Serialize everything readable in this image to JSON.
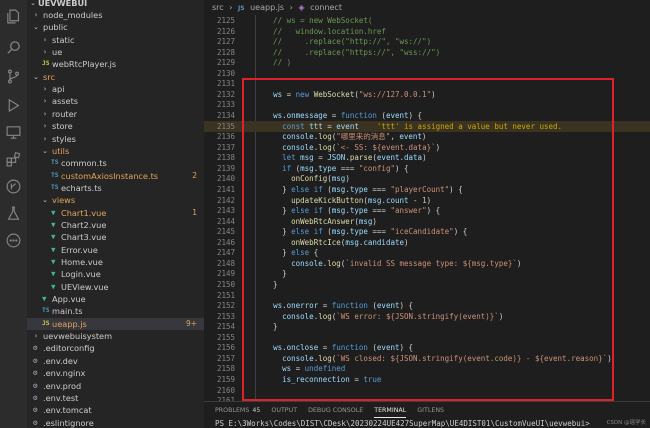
{
  "explorer": {
    "root": "UEVWEBUI",
    "items": [
      {
        "label": "node_modules",
        "type": "folder",
        "depth": 1,
        "open": false
      },
      {
        "label": "public",
        "type": "folder",
        "depth": 1,
        "open": true
      },
      {
        "label": "static",
        "type": "folder",
        "depth": 2,
        "open": false
      },
      {
        "label": "ue",
        "type": "folder",
        "depth": 2,
        "open": false
      },
      {
        "label": "webRtcPlayer.js",
        "type": "js",
        "depth": 2
      },
      {
        "label": "src",
        "type": "folder",
        "depth": 1,
        "open": true,
        "modified": true
      },
      {
        "label": "api",
        "type": "folder",
        "depth": 2,
        "open": false
      },
      {
        "label": "assets",
        "type": "folder",
        "depth": 2,
        "open": false
      },
      {
        "label": "router",
        "type": "folder",
        "depth": 2,
        "open": false
      },
      {
        "label": "store",
        "type": "folder",
        "depth": 2,
        "open": false
      },
      {
        "label": "styles",
        "type": "folder",
        "depth": 2,
        "open": false
      },
      {
        "label": "utils",
        "type": "folder",
        "depth": 2,
        "open": true,
        "modified": true
      },
      {
        "label": "common.ts",
        "type": "ts",
        "depth": 3
      },
      {
        "label": "customAxiosInstance.ts",
        "type": "ts",
        "depth": 3,
        "modified": true,
        "badge": "2"
      },
      {
        "label": "echarts.ts",
        "type": "ts",
        "depth": 3
      },
      {
        "label": "views",
        "type": "folder",
        "depth": 2,
        "open": true,
        "modified": true
      },
      {
        "label": "Chart1.vue",
        "type": "vue",
        "depth": 3,
        "modified": true,
        "badge": "1"
      },
      {
        "label": "Chart2.vue",
        "type": "vue",
        "depth": 3
      },
      {
        "label": "Chart3.vue",
        "type": "vue",
        "depth": 3
      },
      {
        "label": "Error.vue",
        "type": "vue",
        "depth": 3
      },
      {
        "label": "Home.vue",
        "type": "vue",
        "depth": 3
      },
      {
        "label": "Login.vue",
        "type": "vue",
        "depth": 3
      },
      {
        "label": "UEView.vue",
        "type": "vue",
        "depth": 3
      },
      {
        "label": "App.vue",
        "type": "vue",
        "depth": 2
      },
      {
        "label": "main.ts",
        "type": "ts",
        "depth": 2
      },
      {
        "label": "ueapp.js",
        "type": "js",
        "depth": 2,
        "modified": true,
        "selected": true,
        "badge": "9+"
      },
      {
        "label": "uevwebuisystem",
        "type": "folder",
        "depth": 1,
        "open": false
      },
      {
        "label": ".editorconfig",
        "type": "gear",
        "depth": 1
      },
      {
        "label": ".env.dev",
        "type": "gear",
        "depth": 1
      },
      {
        "label": ".env.nginx",
        "type": "gear",
        "depth": 1
      },
      {
        "label": ".env.prod",
        "type": "gear",
        "depth": 1
      },
      {
        "label": ".env.test",
        "type": "gear",
        "depth": 1
      },
      {
        "label": ".env.tomcat",
        "type": "gear",
        "depth": 1
      },
      {
        "label": ".eslintignore",
        "type": "gear",
        "depth": 1
      }
    ]
  },
  "breadcrumb": {
    "folder": "src",
    "file": "ueapp.js",
    "symbol": "connect"
  },
  "code": {
    "lines": [
      {
        "n": "2125",
        "t": "    // ws = new WebSocket("
      },
      {
        "n": "2126",
        "t": "    //   window.location.href"
      },
      {
        "n": "2127",
        "t": "    //     .replace(\"http://\", \"ws://\")"
      },
      {
        "n": "2128",
        "t": "    //     .replace(\"https://\", \"wss://\")"
      },
      {
        "n": "2129",
        "t": "    // )"
      },
      {
        "n": "2130",
        "t": ""
      },
      {
        "n": "2131",
        "t": ""
      },
      {
        "n": "2132",
        "t": "    ws = new WebSocket(\"ws://127.0.0.1\")"
      },
      {
        "n": "2133",
        "t": ""
      },
      {
        "n": "2134",
        "t": "    ws.onmessage = function (event) {"
      },
      {
        "n": "2135",
        "t": "      const ttt = event    'ttt' is assigned a value but never used.",
        "warn": true
      },
      {
        "n": "2136",
        "t": "      console.log(\"哪里来的消息\", event)"
      },
      {
        "n": "2137",
        "t": "      console.log(`<- SS: ${event.data}`)"
      },
      {
        "n": "2138",
        "t": "      let msg = JSON.parse(event.data)"
      },
      {
        "n": "2139",
        "t": "      if (msg.type === \"config\") {"
      },
      {
        "n": "2140",
        "t": "        onConfig(msg)"
      },
      {
        "n": "2141",
        "t": "      } else if (msg.type === \"playerCount\") {"
      },
      {
        "n": "2142",
        "t": "        updateKickButton(msg.count - 1)"
      },
      {
        "n": "2143",
        "t": "      } else if (msg.type === \"answer\") {"
      },
      {
        "n": "2144",
        "t": "        onWebRtcAnswer(msg)"
      },
      {
        "n": "2145",
        "t": "      } else if (msg.type === \"iceCandidate\") {"
      },
      {
        "n": "2146",
        "t": "        onWebRtcIce(msg.candidate)"
      },
      {
        "n": "2147",
        "t": "      } else {"
      },
      {
        "n": "2148",
        "t": "        console.log(`invalid SS message type: ${msg.type}`)"
      },
      {
        "n": "2149",
        "t": "      }"
      },
      {
        "n": "2150",
        "t": "    }"
      },
      {
        "n": "2151",
        "t": ""
      },
      {
        "n": "2152",
        "t": "    ws.onerror = function (event) {"
      },
      {
        "n": "2153",
        "t": "      console.log(`WS error: ${JSON.stringify(event)}`)"
      },
      {
        "n": "2154",
        "t": "    }"
      },
      {
        "n": "2155",
        "t": ""
      },
      {
        "n": "2156",
        "t": "    ws.onclose = function (event) {"
      },
      {
        "n": "2157",
        "t": "      console.log(`WS closed: ${JSON.stringify(event.code)} - ${event.reason}`)"
      },
      {
        "n": "2158",
        "t": "      ws = undefined"
      },
      {
        "n": "2159",
        "t": "      is_reconnection = true"
      },
      {
        "n": "2160",
        "t": ""
      },
      {
        "n": "2161",
        "t": ""
      }
    ]
  },
  "panel": {
    "tabs": [
      {
        "label": "PROBLEMS",
        "badge": "45"
      },
      {
        "label": "OUTPUT"
      },
      {
        "label": "DEBUG CONSOLE"
      },
      {
        "label": "TERMINAL",
        "active": true
      },
      {
        "label": "GITLENS"
      }
    ],
    "terminal_line": "PS E:\\3Works\\Codes\\DIST\\CDesk\\20230224UE427SuperMap\\UE4DIST01\\CustomVueUI\\uevwebui>",
    "watermark": "CSDN @瑶学长"
  },
  "colors": {
    "keyword": "#569cd6",
    "string": "#ce9178",
    "function": "#dcdcaa",
    "variable": "#9cdcfe",
    "comment": "#6a9955",
    "number": "#b5cea8",
    "warning": "#cca700",
    "highlight_box": "#e0202a",
    "modified": "#e2a55a",
    "selection": "#37373d"
  }
}
